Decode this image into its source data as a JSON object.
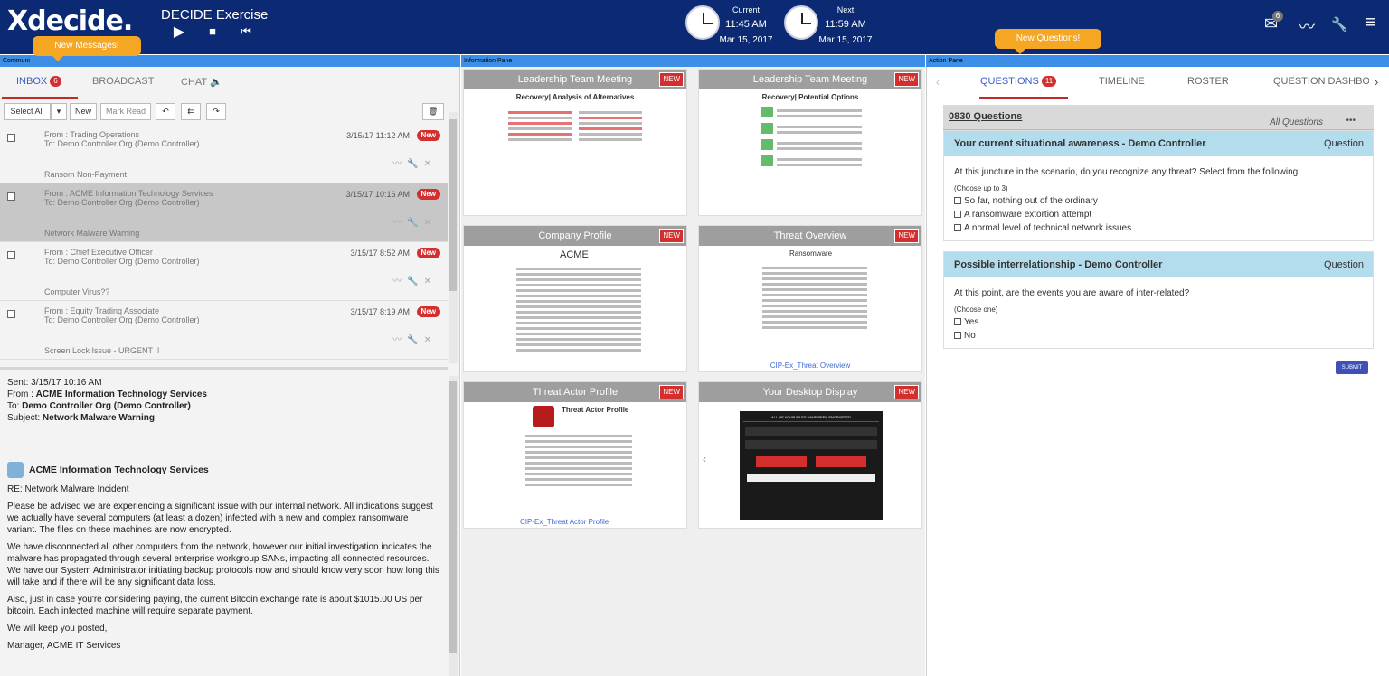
{
  "app": {
    "logo": "Xdecide.",
    "title": "DECIDE Exercise",
    "play_icon": "▶",
    "stop_icon": "■",
    "rewind_icon": "⏮"
  },
  "clocks": {
    "current": {
      "label": "Current",
      "time": "11:45 AM",
      "date": "Mar 15, 2017"
    },
    "next": {
      "label": "Next",
      "time": "11:59 AM",
      "date": "Mar 15, 2017"
    }
  },
  "topicons": {
    "mail_badge": "6",
    "mail_icon": "✉",
    "chart_icon": "〰",
    "wrench_icon": "🔧",
    "menu_icon": "≡"
  },
  "panes": {
    "communications": "Communi",
    "information": "Information Pane",
    "action": "Action Pane"
  },
  "tooltips": {
    "new_messages": "New Messages!",
    "new_questions": "New Questions!"
  },
  "comm": {
    "tabs": {
      "inbox": "INBOX",
      "inbox_count": "6",
      "broadcast": "BROADCAST",
      "chat": "CHAT"
    },
    "toolbar": {
      "select_all": "Select All",
      "new": "New",
      "mark_read": "Mark Read"
    },
    "messages": [
      {
        "from": "From : Trading Operations",
        "to": "To: Demo Controller Org (Demo Controller)",
        "date": "3/15/17 11:12 AM",
        "badge": "New",
        "subject": "Ransom Non-Payment"
      },
      {
        "from": "From : ACME Information Technology Services",
        "to": "To: Demo Controller Org (Demo Controller)",
        "date": "3/15/17 10:16 AM",
        "badge": "New",
        "subject": "Network Malware Warning"
      },
      {
        "from": "From : Chief Executive Officer",
        "to": "To: Demo Controller Org (Demo Controller)",
        "date": "3/15/17 8:52 AM",
        "badge": "New",
        "subject": "Computer Virus??"
      },
      {
        "from": "From : Equity Trading Associate",
        "to": "To: Demo Controller Org (Demo Controller)",
        "date": "3/15/17 8:19 AM",
        "badge": "New",
        "subject": "Screen Lock Issue - URGENT !!"
      }
    ],
    "reader": {
      "sent": "Sent: 3/15/17 10:16 AM",
      "from_label": "From : ",
      "from": "ACME Information Technology Services",
      "to_label": "To: ",
      "to": "Demo Controller Org (Demo Controller)",
      "subject_label": "Subject: ",
      "subject": "Network Malware Warning",
      "org": "ACME Information Technology Services",
      "re": "RE: Network Malware Incident",
      "p1": "Please be advised we are experiencing a significant issue with our internal network. All indications suggest we actually have several computers (at least a dozen) infected with a new and complex ransomware variant. The files on these machines are now encrypted.",
      "p2": "We have disconnected all other computers from the network, however our initial investigation indicates the malware has propagated through several enterprise workgroup SANs, impacting all connected resources. We have our System Administrator initiating backup protocols now and should know very soon how long this will take and if there will be any significant data loss.",
      "p3": "Also, just in case you're considering paying, the current Bitcoin exchange rate is about $1015.00 US per bitcoin. Each infected machine will require separate payment.",
      "p4": "We will keep you posted,",
      "p5": "Manager, ACME IT Services"
    }
  },
  "info": {
    "cards": [
      {
        "title": "Leadership Team Meeting",
        "tag": "NEW",
        "subtitle": "Recovery| Analysis of Alternatives",
        "caption": ""
      },
      {
        "title": "Leadership Team Meeting",
        "tag": "NEW",
        "subtitle": "Recovery| Potential Options",
        "caption": ""
      },
      {
        "title": "Company Profile",
        "tag": "NEW",
        "subtitle": "ACME",
        "caption": ""
      },
      {
        "title": "Threat Overview",
        "tag": "NEW",
        "subtitle": "Ransomware",
        "caption": "CIP-Ex_Threat Overview"
      },
      {
        "title": "Threat Actor Profile",
        "tag": "NEW",
        "subtitle": "Threat Actor Profile",
        "caption": "CIP-Ex_Threat Actor Profile"
      },
      {
        "title": "Your Desktop Display",
        "tag": "NEW",
        "subtitle": "ALL OF YOUR FILES HAVE BEEN ENCRYPTED",
        "caption": ""
      }
    ]
  },
  "action": {
    "tabs": {
      "questions": "QUESTIONS",
      "questions_count": "11",
      "timeline": "TIMELINE",
      "roster": "ROSTER",
      "dashboard": "QUESTION DASHBOA"
    },
    "group": {
      "title": "0830 Questions",
      "filter": "All Questions",
      "more": "•••"
    },
    "questions": [
      {
        "title": "Your current situational awareness - Demo Controller",
        "type": "Question",
        "text": "At this juncture in the scenario, do you recognize any threat? Select from the following:",
        "hint": "(Choose up to 3)",
        "options": [
          "So far, nothing out of the ordinary",
          "A ransomware extortion attempt",
          "A normal level of technical network issues"
        ]
      },
      {
        "title": "Possible interrelationship - Demo Controller",
        "type": "Question",
        "text": "At this point, are the events you are aware of inter-related?",
        "hint": "(Choose one)",
        "options": [
          "Yes",
          "No"
        ]
      }
    ],
    "submit": "SUBMIT"
  }
}
